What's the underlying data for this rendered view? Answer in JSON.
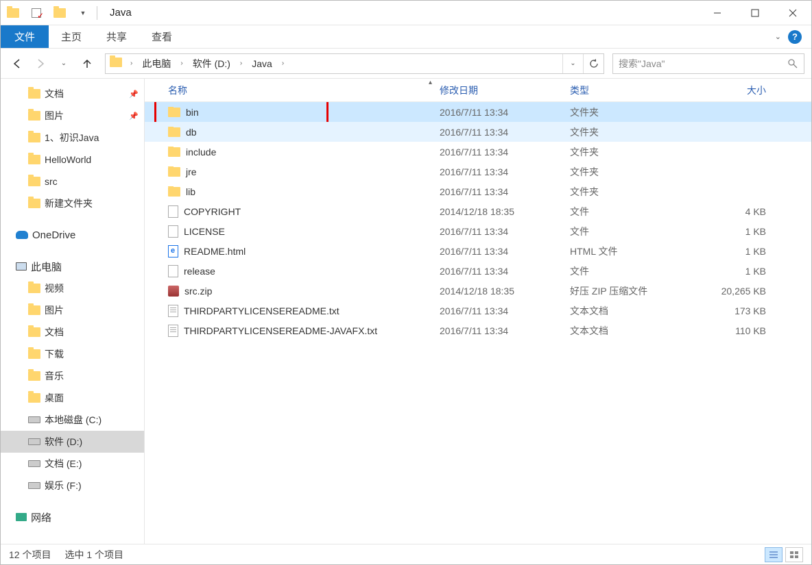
{
  "title": "Java",
  "ribbon": {
    "file": "文件",
    "home": "主页",
    "share": "共享",
    "view": "查看"
  },
  "breadcrumbs": [
    "此电脑",
    "软件 (D:)",
    "Java"
  ],
  "search_placeholder": "搜索\"Java\"",
  "sidebar": {
    "quick": [
      {
        "label": "文档",
        "icon": "folder",
        "pinned": true
      },
      {
        "label": "图片",
        "icon": "folder",
        "pinned": true
      },
      {
        "label": "1、初识Java",
        "icon": "folder"
      },
      {
        "label": "HelloWorld",
        "icon": "folder"
      },
      {
        "label": "src",
        "icon": "folder"
      },
      {
        "label": "新建文件夹",
        "icon": "folder"
      }
    ],
    "onedrive": "OneDrive",
    "thispc": "此电脑",
    "pcitems": [
      {
        "label": "视频",
        "icon": "folder"
      },
      {
        "label": "图片",
        "icon": "folder"
      },
      {
        "label": "文档",
        "icon": "folder"
      },
      {
        "label": "下载",
        "icon": "folder"
      },
      {
        "label": "音乐",
        "icon": "folder"
      },
      {
        "label": "桌面",
        "icon": "folder"
      },
      {
        "label": "本地磁盘 (C:)",
        "icon": "drive"
      },
      {
        "label": "软件 (D:)",
        "icon": "drive",
        "selected": true
      },
      {
        "label": "文档 (E:)",
        "icon": "drive"
      },
      {
        "label": "娱乐 (F:)",
        "icon": "drive"
      }
    ],
    "network": "网络"
  },
  "columns": {
    "name": "名称",
    "date": "修改日期",
    "type": "类型",
    "size": "大小"
  },
  "files": [
    {
      "name": "bin",
      "date": "2016/7/11 13:34",
      "type": "文件夹",
      "size": "",
      "icon": "folder",
      "selected": true,
      "highlight": true
    },
    {
      "name": "db",
      "date": "2016/7/11 13:34",
      "type": "文件夹",
      "size": "",
      "icon": "folder",
      "hover": true
    },
    {
      "name": "include",
      "date": "2016/7/11 13:34",
      "type": "文件夹",
      "size": "",
      "icon": "folder"
    },
    {
      "name": "jre",
      "date": "2016/7/11 13:34",
      "type": "文件夹",
      "size": "",
      "icon": "folder"
    },
    {
      "name": "lib",
      "date": "2016/7/11 13:34",
      "type": "文件夹",
      "size": "",
      "icon": "folder"
    },
    {
      "name": "COPYRIGHT",
      "date": "2014/12/18 18:35",
      "type": "文件",
      "size": "4 KB",
      "icon": "file"
    },
    {
      "name": "LICENSE",
      "date": "2016/7/11 13:34",
      "type": "文件",
      "size": "1 KB",
      "icon": "file"
    },
    {
      "name": "README.html",
      "date": "2016/7/11 13:34",
      "type": "HTML 文件",
      "size": "1 KB",
      "icon": "html"
    },
    {
      "name": "release",
      "date": "2016/7/11 13:34",
      "type": "文件",
      "size": "1 KB",
      "icon": "file"
    },
    {
      "name": "src.zip",
      "date": "2014/12/18 18:35",
      "type": "好压 ZIP 压缩文件",
      "size": "20,265 KB",
      "icon": "zip"
    },
    {
      "name": "THIRDPARTYLICENSEREADME.txt",
      "date": "2016/7/11 13:34",
      "type": "文本文档",
      "size": "173 KB",
      "icon": "txt"
    },
    {
      "name": "THIRDPARTYLICENSEREADME-JAVAFX.txt",
      "date": "2016/7/11 13:34",
      "type": "文本文档",
      "size": "110 KB",
      "icon": "txt"
    }
  ],
  "status": {
    "count": "12 个项目",
    "selected": "选中 1 个项目"
  }
}
